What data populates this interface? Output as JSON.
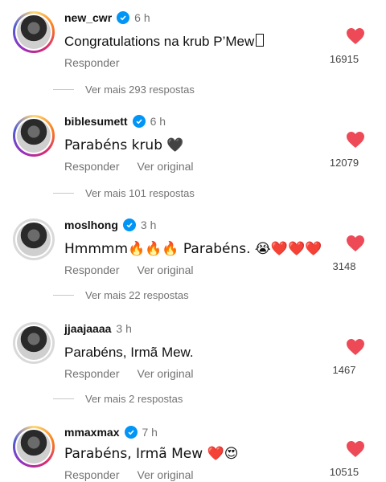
{
  "comments": [
    {
      "username": "new_cwr",
      "time": "6 h",
      "text": "Congratulations na krub P’Mew",
      "reply": "Responder",
      "view_original": "",
      "likes": "16915",
      "more_replies": "Ver mais 293 respostas"
    },
    {
      "username": "biblesumett",
      "time": "6 h",
      "text": "Parabéns krub 🖤",
      "reply": "Responder",
      "view_original": "Ver original",
      "likes": "12079",
      "more_replies": "Ver mais 101 respostas"
    },
    {
      "username": "moslhong",
      "time": "3 h",
      "text": "Hmmmm🔥🔥🔥 Parabéns. 😭❤️❤️❤️",
      "reply": "Responder",
      "view_original": "Ver original",
      "likes": "3148",
      "more_replies": "Ver mais 22 respostas"
    },
    {
      "username": "jjaajaaaa",
      "time": "3 h",
      "text": "Parabéns, Irmã Mew.",
      "reply": "Responder",
      "view_original": "Ver original",
      "likes": "1467",
      "more_replies": "Ver mais 2 respostas"
    },
    {
      "username": "mmaxmax",
      "time": "7 h",
      "text": "Parabéns, Irmã Mew ❤️😍",
      "reply": "Responder",
      "view_original": "Ver original",
      "likes": "10515",
      "more_replies": ""
    }
  ],
  "colors": {
    "heart": "#ed4956",
    "verified": "#0095f6",
    "muted_text": "#737373"
  },
  "icons": {
    "like": "heart-icon",
    "verified": "verified-badge-icon"
  }
}
